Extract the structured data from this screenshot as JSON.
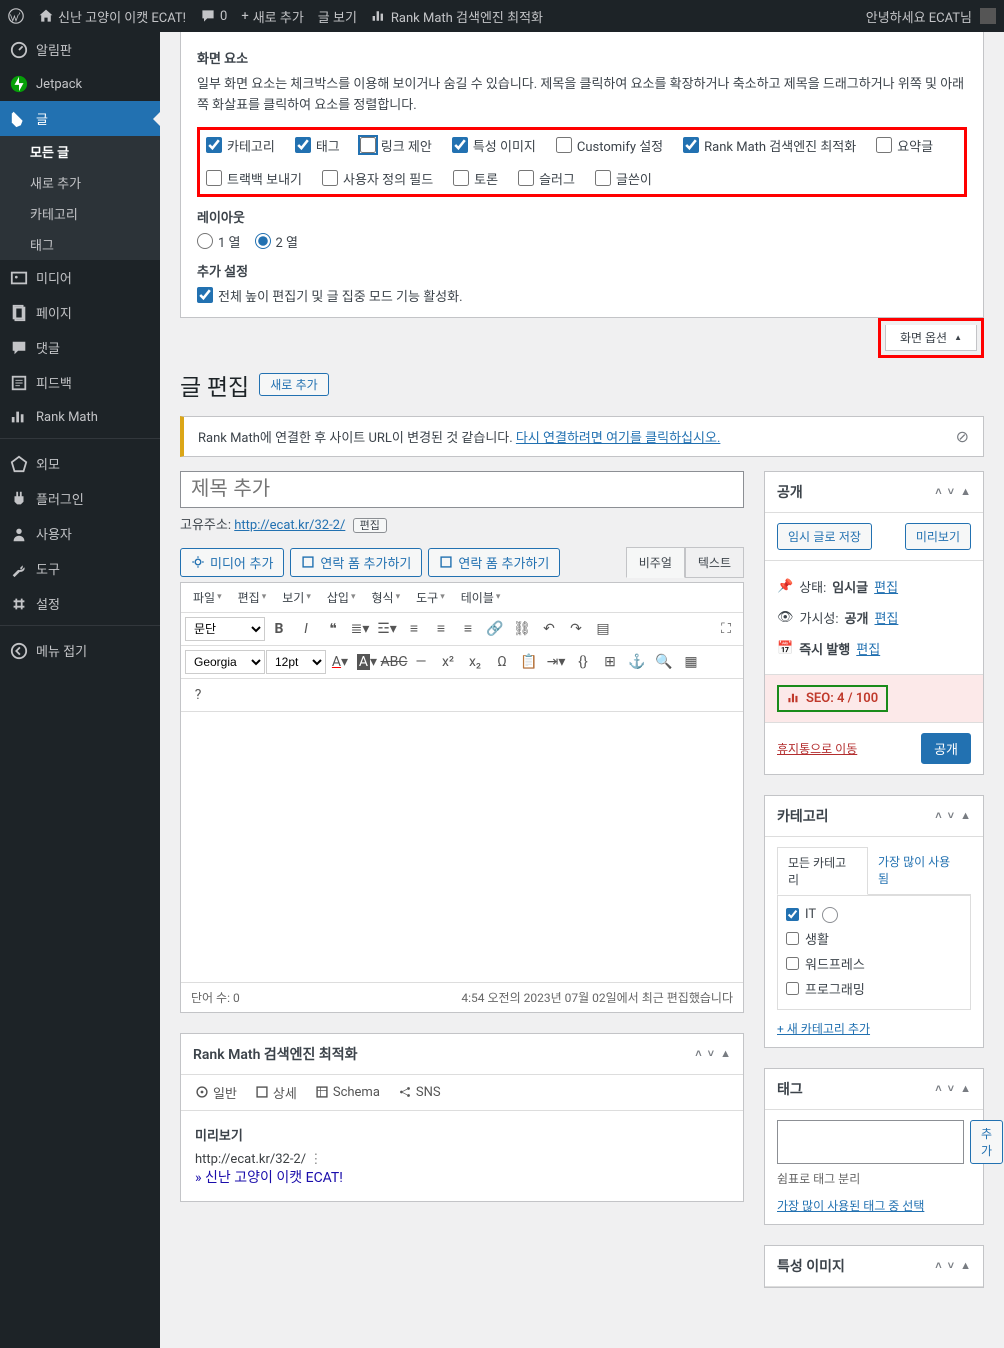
{
  "adminbar": {
    "site_name": "신난 고양이 이캣 ECAT!",
    "comments_count": "0",
    "new": "새로 추가",
    "view": "글 보기",
    "rankmath": "Rank Math 검색엔진 최적화",
    "greeting": "안녕하세요 ECAT님"
  },
  "menu": {
    "dashboard": "알림판",
    "jetpack": "Jetpack",
    "posts": "글",
    "all_posts": "모든 글",
    "add_new": "새로 추가",
    "categories": "카테고리",
    "tags": "태그",
    "media": "미디어",
    "pages": "페이지",
    "comments": "댓글",
    "feedback": "피드백",
    "rankmath": "Rank Math",
    "appearance": "외모",
    "plugins": "플러그인",
    "users": "사용자",
    "tools": "도구",
    "settings": "설정",
    "collapse": "메뉴 접기"
  },
  "screen": {
    "elements_title": "화면 요소",
    "elements_desc": "일부 화면 요소는 체크박스를 이용해 보이거나 숨길 수 있습니다. 제목을 클릭하여 요소를 확장하거나 축소하고 제목을 드래그하거나 위쪽 및 아래쪽 화살표를 클릭하여 요소를 정렬합니다.",
    "cb_category": "카테고리",
    "cb_tag": "태그",
    "cb_linksuggest": "링크 제안",
    "cb_featimg": "특성 이미지",
    "cb_customify": "Customify 설정",
    "cb_rankmath": "Rank Math 검색엔진 최적화",
    "cb_excerpt": "요약글",
    "cb_trackback": "트랙백 보내기",
    "cb_customfields": "사용자 정의 필드",
    "cb_discussion": "토론",
    "cb_slug": "슬러그",
    "cb_author": "글쓴이",
    "layout_title": "레이아웃",
    "col1": "1 열",
    "col2": "2 열",
    "extra_title": "추가 설정",
    "extra_cb": "전체 높이 편집기 및 글 집중 모드 기능 활성화.",
    "tab": "화면 옵션"
  },
  "page": {
    "heading": "글 편집",
    "add_new_btn": "새로 추가"
  },
  "notice": {
    "text": "Rank Math에 연결한 후 사이트 URL이 변경된 것 같습니다. ",
    "link": "다시 연결하려면 여기를 클릭하십시오."
  },
  "title_placeholder": "제목 추가",
  "permalink": {
    "label": "고유주소:",
    "url": "http://ecat.kr/32-2/",
    "edit": "편집"
  },
  "editor": {
    "add_media": "미디어 추가",
    "add_form1": "연락 폼 추가하기",
    "add_form2": "연락 폼 추가하기",
    "tab_visual": "비주얼",
    "tab_text": "텍스트",
    "menu_file": "파일",
    "menu_edit": "편집",
    "menu_view": "보기",
    "menu_insert": "삽입",
    "menu_format": "형식",
    "menu_tools": "도구",
    "menu_table": "테이블",
    "sel_paragraph": "문단",
    "sel_font": "Georgia",
    "sel_size": "12pt",
    "wordcount": "단어 수: 0",
    "lastedit": "4:54 오전의 2023년 07월 02일에서 최근 편집했습니다"
  },
  "publish": {
    "title": "공개",
    "save_draft": "임시 글로 저장",
    "preview": "미리보기",
    "status_label": "상태:",
    "status_val": "임시글",
    "edit": "편집",
    "visibility_label": "가시성:",
    "visibility_val": "공개",
    "schedule_label": "즉시 발행",
    "seo": "SEO: 4 / 100",
    "trash": "휴지통으로 이동",
    "publish_btn": "공개"
  },
  "catbox": {
    "title": "카테고리",
    "tab_all": "모든 카테고리",
    "tab_most": "가장 많이 사용됨",
    "c1": "IT",
    "c2": "생활",
    "c3": "워드프레스",
    "c4": "프로그래밍",
    "add": "+ 새 카테고리 추가"
  },
  "tagbox": {
    "title": "태그",
    "add": "추가",
    "hint": "쉼표로 태그 분리",
    "popular": "가장 많이 사용된 태그 중 선택"
  },
  "featimg": {
    "title": "특성 이미지"
  },
  "rm": {
    "title": "Rank Math 검색엔진 최적화",
    "tab_general": "일반",
    "tab_advanced": "상세",
    "tab_schema": "Schema",
    "tab_sns": "SNS",
    "preview_title": "미리보기",
    "url": "http://ecat.kr/32-2/",
    "site_title": "» 신난 고양이 이캣 ECAT!"
  }
}
